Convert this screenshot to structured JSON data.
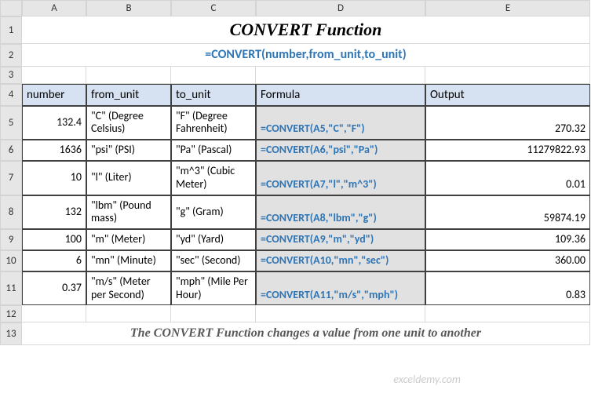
{
  "columns": [
    "A",
    "B",
    "C",
    "D",
    "E"
  ],
  "rowNumbers": [
    "1",
    "2",
    "3",
    "4",
    "5",
    "6",
    "7",
    "8",
    "9",
    "10",
    "11",
    "12",
    "13"
  ],
  "title": "CONVERT Function",
  "syntax": "=CONVERT(number,from_unit,to_unit)",
  "headers": {
    "number": "number",
    "from_unit": "from_unit",
    "to_unit": "to_unit",
    "formula": "Formula",
    "output": "Output"
  },
  "rows": [
    {
      "number": "132.4",
      "from": "\"C\" (Degree Celsius)",
      "to": "\"F\" (Degree Fahrenheit)",
      "formula": "=CONVERT(A5,\"C\",\"F\")",
      "output": "270.32",
      "tall": true
    },
    {
      "number": "1636",
      "from": "\"psi\" (PSI)",
      "to": "\"Pa\" (Pascal)",
      "formula": "=CONVERT(A6,\"psi\",\"Pa\")",
      "output": "11279822.93",
      "tall": false
    },
    {
      "number": "10",
      "from": "\"l\" (Liter)",
      "to": "\"m^3\" (Cubic Meter)",
      "formula": "=CONVERT(A7,\"l\",\"m^3\")",
      "output": "0.01",
      "tall": true
    },
    {
      "number": "132",
      "from": "\"lbm\" (Pound mass)",
      "to": "\"g\" (Gram)",
      "formula": "=CONVERT(A8,\"lbm\",\"g\")",
      "output": "59874.19",
      "tall": true
    },
    {
      "number": "100",
      "from": "\"m\" (Meter)",
      "to": "\"yd\" (Yard)",
      "formula": "=CONVERT(A9,\"m\",\"yd\")",
      "output": "109.36",
      "tall": false
    },
    {
      "number": "6",
      "from": "\"mn\" (Minute)",
      "to": "\"sec\" (Second)",
      "formula": "=CONVERT(A10,\"mn\",\"sec\")",
      "output": "360.00",
      "tall": false
    },
    {
      "number": "0.37",
      "from": "\"m/s\" (Meter per Second)",
      "to": "\"mph\" (Mile Per Hour)",
      "formula": "=CONVERT(A11,\"m/s\",\"mph\")",
      "output": "0.83",
      "tall": true
    }
  ],
  "footer": "The CONVERT Function changes a value from one unit to another",
  "watermark": "exceldemy.com",
  "chart_data": {
    "type": "table",
    "title": "CONVERT Function",
    "columns": [
      "number",
      "from_unit",
      "to_unit",
      "Formula",
      "Output"
    ],
    "rows": [
      [
        132.4,
        "\"C\" (Degree Celsius)",
        "\"F\" (Degree Fahrenheit)",
        "=CONVERT(A5,\"C\",\"F\")",
        270.32
      ],
      [
        1636,
        "\"psi\" (PSI)",
        "\"Pa\" (Pascal)",
        "=CONVERT(A6,\"psi\",\"Pa\")",
        11279822.93
      ],
      [
        10,
        "\"l\" (Liter)",
        "\"m^3\" (Cubic Meter)",
        "=CONVERT(A7,\"l\",\"m^3\")",
        0.01
      ],
      [
        132,
        "\"lbm\" (Pound mass)",
        "\"g\" (Gram)",
        "=CONVERT(A8,\"lbm\",\"g\")",
        59874.19
      ],
      [
        100,
        "\"m\" (Meter)",
        "\"yd\" (Yard)",
        "=CONVERT(A9,\"m\",\"yd\")",
        109.36
      ],
      [
        6,
        "\"mn\" (Minute)",
        "\"sec\" (Second)",
        "=CONVERT(A10,\"mn\",\"sec\")",
        360.0
      ],
      [
        0.37,
        "\"m/s\" (Meter per Second)",
        "\"mph\" (Mile Per Hour)",
        "=CONVERT(A11,\"m/s\",\"mph\")",
        0.83
      ]
    ]
  }
}
